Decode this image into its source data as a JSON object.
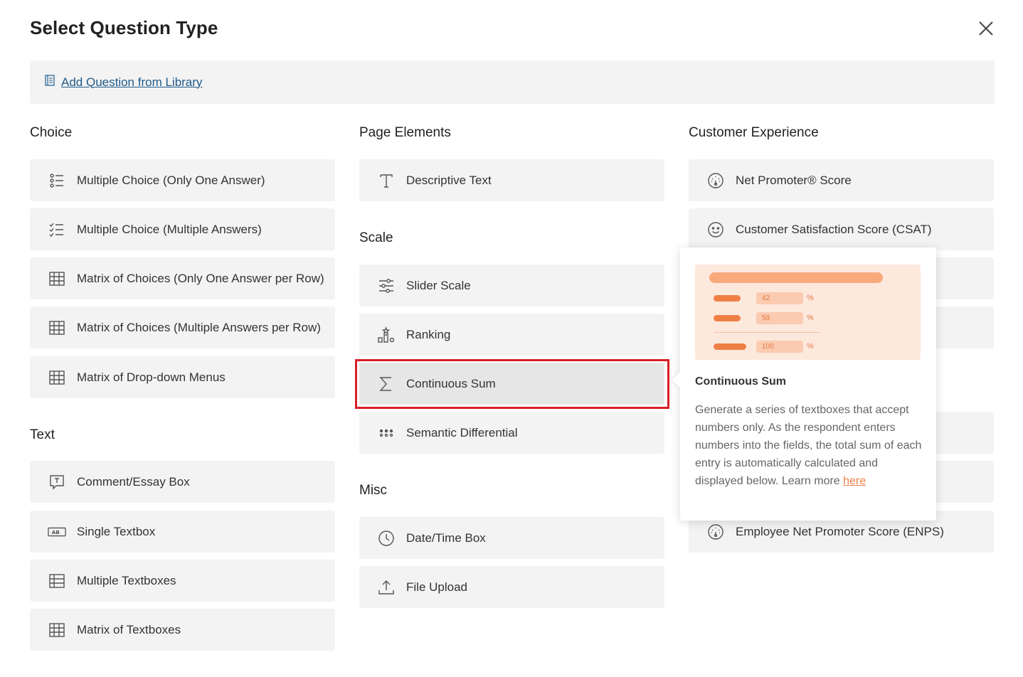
{
  "dialog": {
    "title": "Select Question Type"
  },
  "library": {
    "label": "Add Question from Library"
  },
  "sections": {
    "choice": "Choice",
    "text": "Text",
    "page_elements": "Page Elements",
    "scale": "Scale",
    "misc": "Misc",
    "customer_experience": "Customer Experience"
  },
  "choice_items": [
    {
      "label": "Multiple Choice (Only One Answer)",
      "icon": "radio-list-icon"
    },
    {
      "label": "Multiple Choice (Multiple Answers)",
      "icon": "checklist-icon"
    },
    {
      "label": "Matrix of Choices (Only One Answer per Row)",
      "icon": "grid-icon"
    },
    {
      "label": "Matrix of Choices (Multiple Answers per Row)",
      "icon": "grid-icon"
    },
    {
      "label": "Matrix of Drop-down Menus",
      "icon": "grid-icon"
    }
  ],
  "text_items": [
    {
      "label": "Comment/Essay Box",
      "icon": "comment-icon"
    },
    {
      "label": "Single Textbox",
      "icon": "textbox-ab-icon"
    },
    {
      "label": "Multiple Textboxes",
      "icon": "table-icon"
    },
    {
      "label": "Matrix of Textboxes",
      "icon": "grid-icon"
    }
  ],
  "page_element_items": [
    {
      "label": "Descriptive Text",
      "icon": "text-t-icon"
    }
  ],
  "scale_items": [
    {
      "label": "Slider Scale",
      "icon": "slider-icon"
    },
    {
      "label": "Ranking",
      "icon": "ranking-icon"
    },
    {
      "label": "Continuous Sum",
      "icon": "sigma-icon"
    },
    {
      "label": "Semantic Differential",
      "icon": "dots-grid-icon"
    }
  ],
  "misc_items": [
    {
      "label": "Date/Time Box",
      "icon": "clock-icon"
    },
    {
      "label": "File Upload",
      "icon": "upload-icon"
    }
  ],
  "cx_items": [
    {
      "label": "Net Promoter® Score",
      "icon": "gauge-icon"
    },
    {
      "label": "Customer Satisfaction Score (CSAT)",
      "icon": "smiley-icon"
    },
    {
      "label": "Employee Net Promoter Score (ENPS)",
      "icon": "gauge-icon"
    }
  ],
  "popover": {
    "title": "Continuous Sum",
    "description": "Generate a series of textboxes that accept numbers only. As the respondent enters numbers into the fields, the total sum of each entry is automatically calculated and displayed below. Learn more ",
    "link": "here",
    "preview_values": [
      "42",
      "58",
      "100"
    ],
    "preview_pct": "%",
    "accent": "#f07f45"
  },
  "highlight_color": "#d81f26"
}
